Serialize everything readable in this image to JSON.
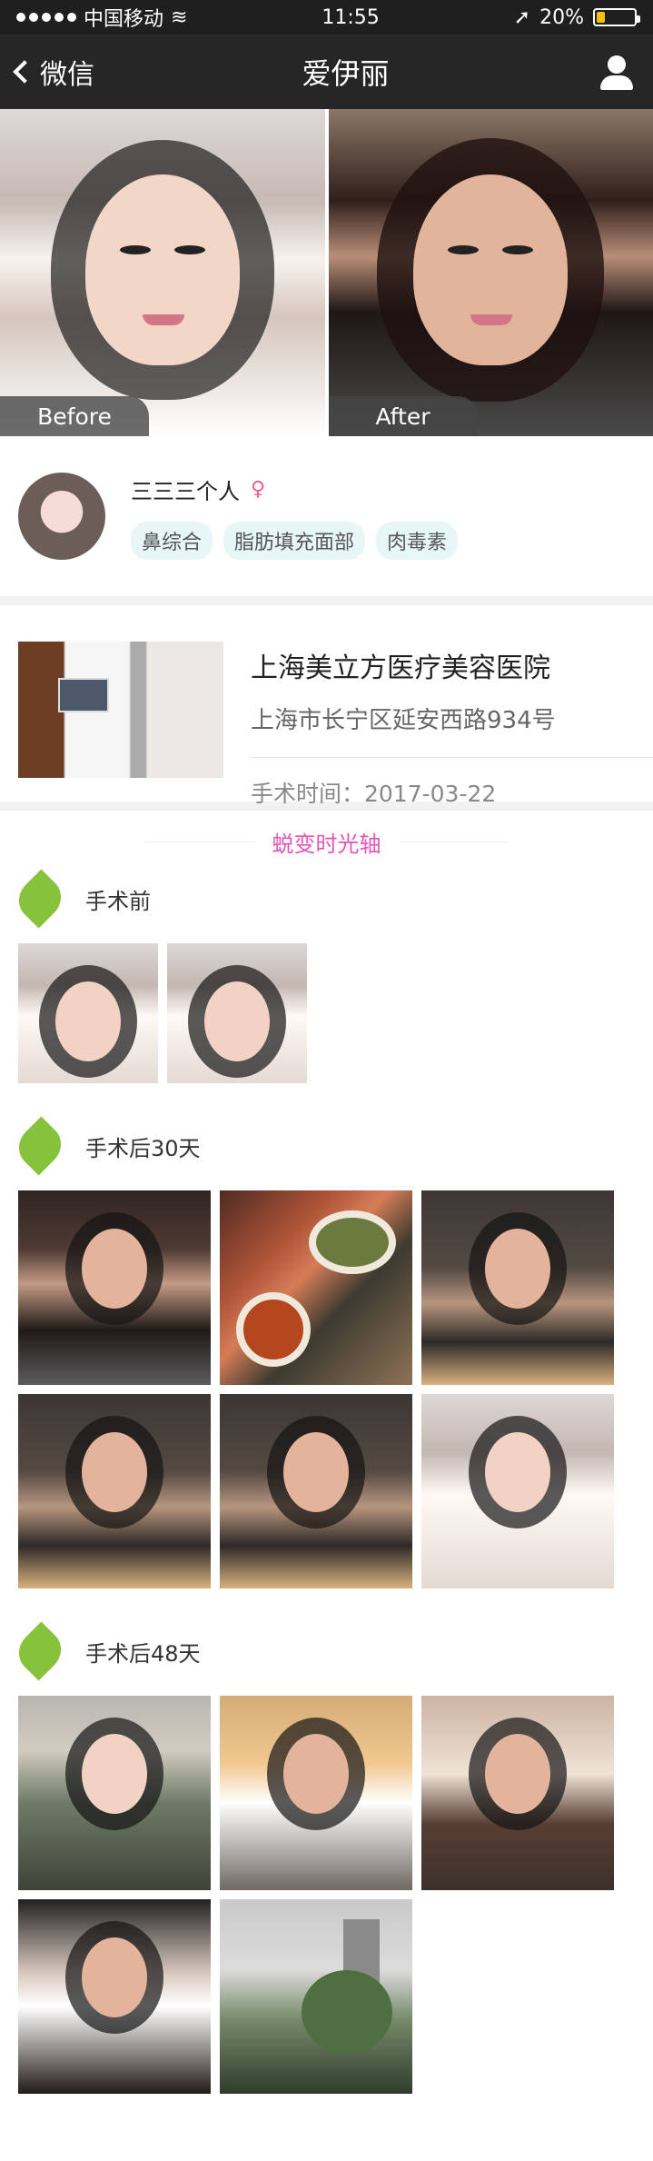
{
  "status": {
    "carrier": "中国移动",
    "time": "11:55",
    "battery": "20%"
  },
  "nav": {
    "back": "微信",
    "title": "爱伊丽",
    "profile_icon": "user-icon"
  },
  "hero": {
    "before": "Before",
    "after": "After"
  },
  "profile": {
    "name": "三三三个人",
    "gender_icon": "female-icon",
    "tags": [
      "鼻综合",
      "脂肪填充面部",
      "肉毒素"
    ]
  },
  "hospital": {
    "name": "上海美立方医疗美容医院",
    "address": "上海市长宁区延安西路934号",
    "surgery_time": "手术时间：2017-03-22"
  },
  "timeline": {
    "title": "蜕变时光轴",
    "stages": [
      {
        "label": "手术前",
        "icon": "leaf-icon"
      },
      {
        "label": "手术后30天",
        "icon": "leaf-icon"
      },
      {
        "label": "手术后48天",
        "icon": "leaf-icon"
      }
    ]
  },
  "colors": {
    "accent": "#e455b6",
    "leaf": "#86c23a",
    "tag": "#e7f6f6"
  }
}
